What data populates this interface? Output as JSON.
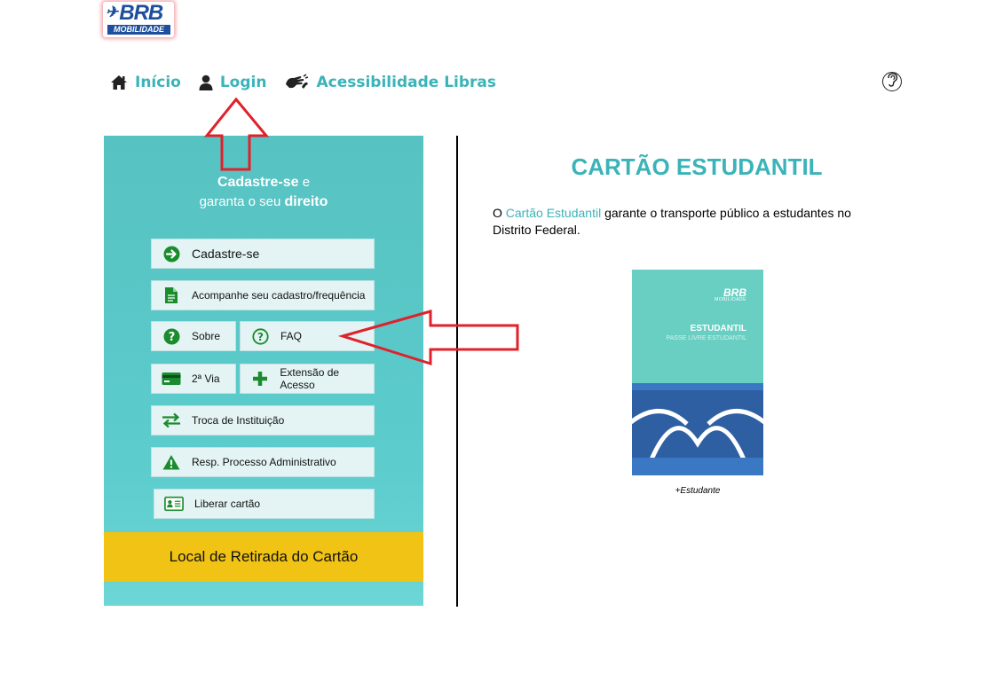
{
  "logo": {
    "main": "BRB",
    "sub": "MOBILIDADE"
  },
  "nav": {
    "items": [
      {
        "label": "Início"
      },
      {
        "label": "Login"
      },
      {
        "label": "Acessibilidade Libras"
      }
    ]
  },
  "panel": {
    "tagline": {
      "strong1": "Cadastre-se",
      "part1": " e",
      "part2": "garanta o seu ",
      "strong2": "direito"
    },
    "buttons": {
      "cadastre": "Cadastre-se",
      "acompanhe": "Acompanhe seu cadastro/frequência",
      "sobre": "Sobre",
      "faq": "FAQ",
      "segunda_via": "2ª Via",
      "extensao": "Extensão de Acesso",
      "troca": "Troca de Instituição",
      "resp": "Resp. Processo Administrativo",
      "liberar": "Liberar cartão"
    },
    "retirada": "Local de Retirada do Cartão"
  },
  "main": {
    "title": "CARTÃO ESTUDANTIL",
    "desc": {
      "prefix": "O ",
      "highlight": "Cartão Estudantil",
      "rest": " garante o transporte público a estudantes no Distrito Federal."
    },
    "card": {
      "brand": "BRB",
      "brand_sub": "MOBILIDADE",
      "title": "ESTUDANTIL",
      "subtitle": "PASSE LIVRE ESTUDANTIL"
    },
    "caption": "+Estudante"
  },
  "colors": {
    "teal": "#3bb3b8",
    "panel": "#5cc8c8",
    "yellow": "#f0c315",
    "green_icon": "#1a8c2e",
    "annotation_red": "#e0212b",
    "brand_blue": "#1e4f9c"
  }
}
